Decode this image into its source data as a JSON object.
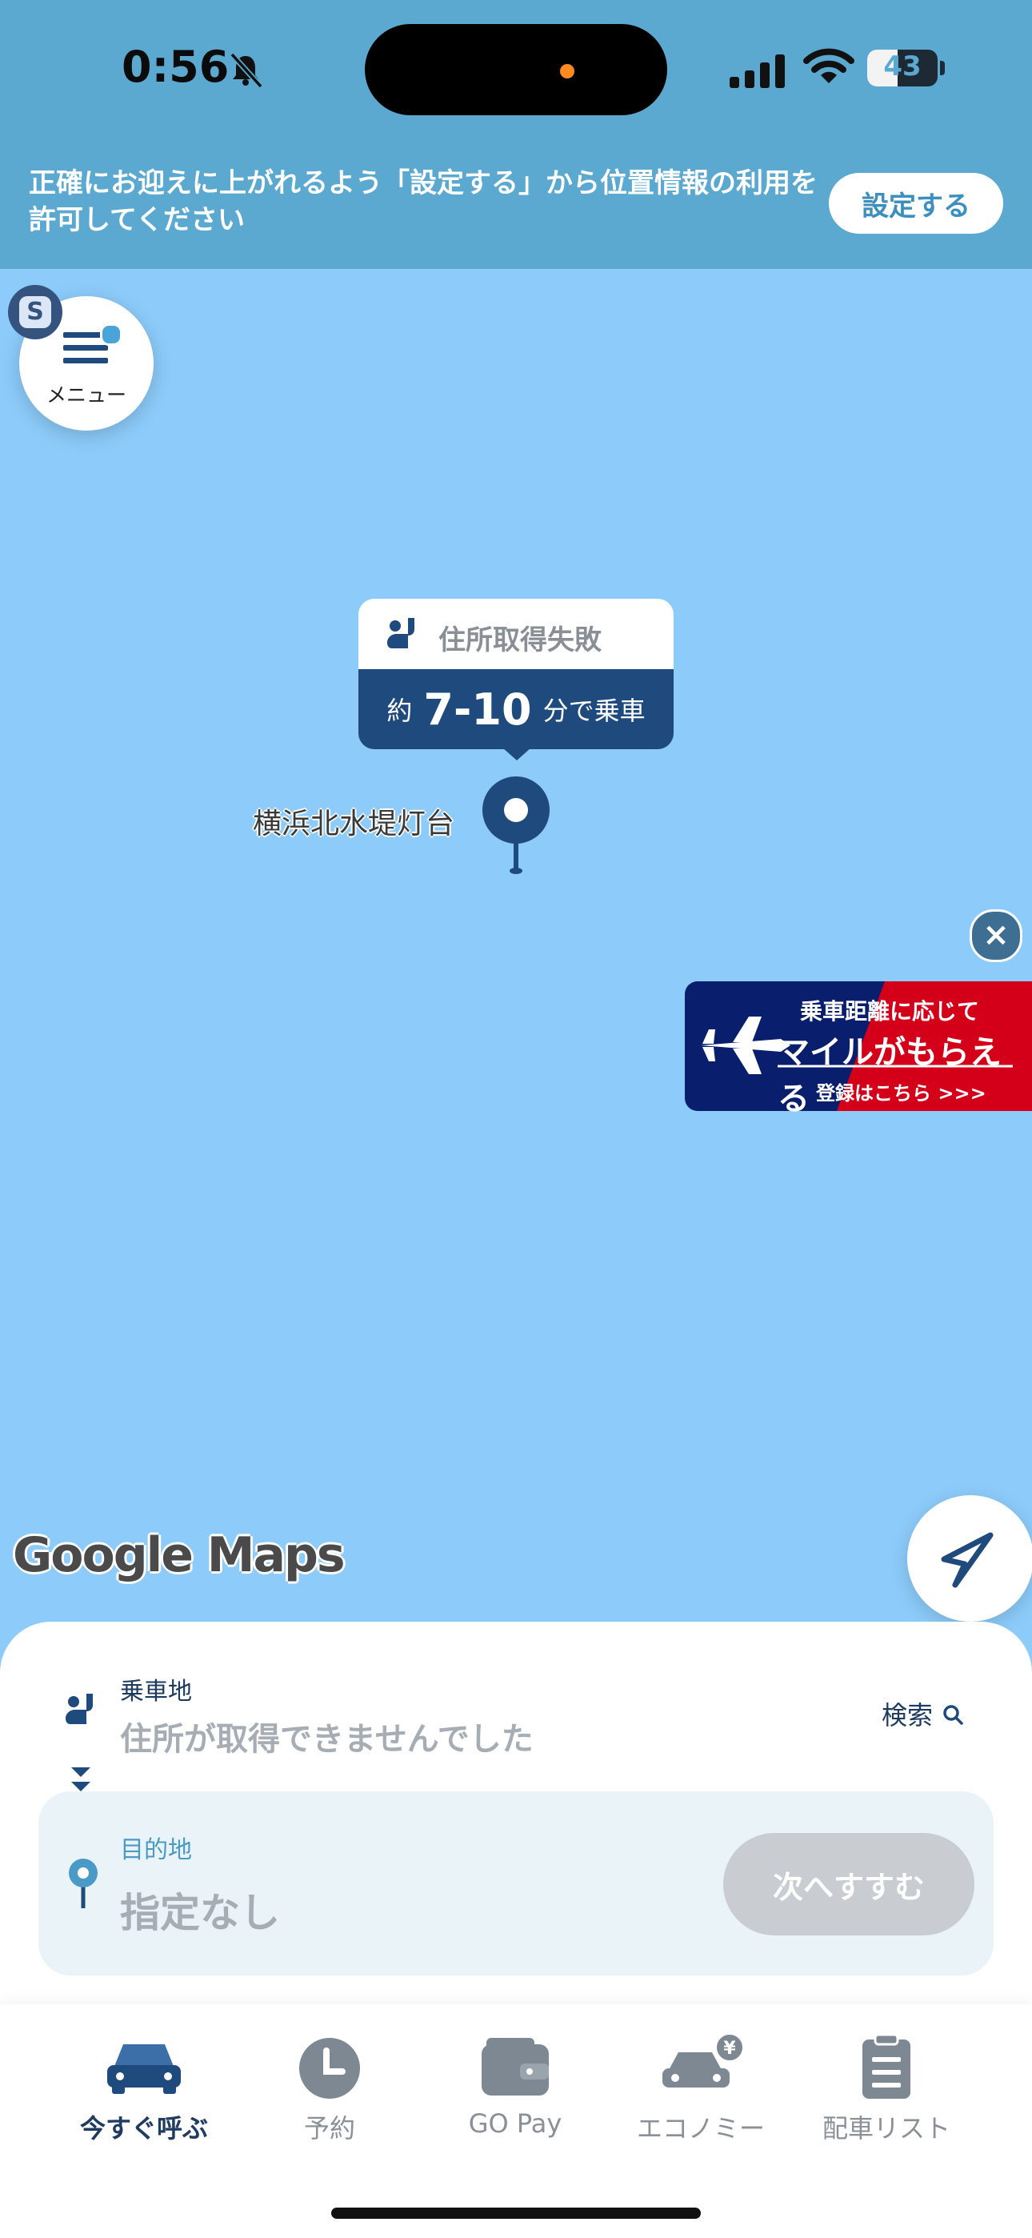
{
  "status_bar": {
    "time": "0:56",
    "battery": "43"
  },
  "banner": {
    "text": "正確にお迎えに上がれるよう「設定する」から位置情報の利用を許可してください",
    "button": "設定する"
  },
  "menu": {
    "label": "メニュー",
    "badge": "S"
  },
  "pickup_tooltip": {
    "title": "住所取得失敗",
    "prefix": "約",
    "range": "7-10",
    "suffix": "分で乗車"
  },
  "map": {
    "place_label": "横浜北水堤灯台",
    "attribution": "Google Maps"
  },
  "ad": {
    "line1": "乗車距離に応じて",
    "line2": "マイルがもらえる",
    "line3": "登録はこちら >>>",
    "close": "×",
    "colors": {
      "navy": "#0a1e6e",
      "red": "#d4001a"
    }
  },
  "sheet": {
    "pickup": {
      "label": "乗車地",
      "value": "住所が取得できませんでした",
      "search": "検索"
    },
    "destination": {
      "label": "目的地",
      "value": "指定なし"
    },
    "next_button": "次へすすむ"
  },
  "tabs": [
    {
      "label": "今すぐ呼ぶ",
      "icon": "car-icon",
      "active": true
    },
    {
      "label": "予約",
      "icon": "clock-icon",
      "active": false
    },
    {
      "label": "GO Pay",
      "icon": "wallet-icon",
      "active": false
    },
    {
      "label": "エコノミー",
      "icon": "economy-car-icon",
      "active": false
    },
    {
      "label": "配車リスト",
      "icon": "clipboard-icon",
      "active": false
    }
  ],
  "colors": {
    "map_water": "#8ccbfa",
    "banner": "#5ba8d0",
    "primary_navy": "#1f4a7d",
    "accent_blue": "#4a9ac8"
  }
}
